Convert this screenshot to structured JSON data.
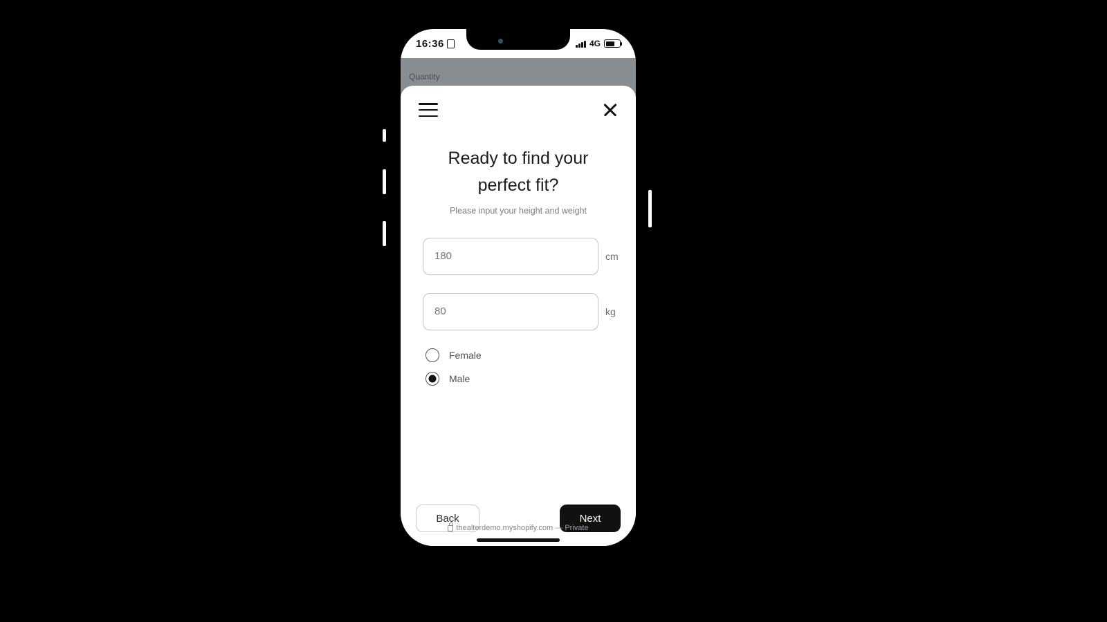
{
  "status": {
    "time": "16:36",
    "network": "4G"
  },
  "background": {
    "quantity_label": "Quantity"
  },
  "modal": {
    "title_line1": "Ready to find your",
    "title_line2": "perfect fit?",
    "subtitle": "Please input your height and weight",
    "height": {
      "placeholder": "180",
      "value": "",
      "unit": "cm"
    },
    "weight": {
      "placeholder": "80",
      "value": "",
      "unit": "kg"
    },
    "gender": {
      "options": [
        {
          "label": "Female",
          "selected": false
        },
        {
          "label": "Male",
          "selected": true
        }
      ]
    },
    "back_label": "Back",
    "next_label": "Next"
  },
  "browser": {
    "host": "thealterdemo.myshopify.com",
    "separator": " — ",
    "mode": "Private"
  }
}
